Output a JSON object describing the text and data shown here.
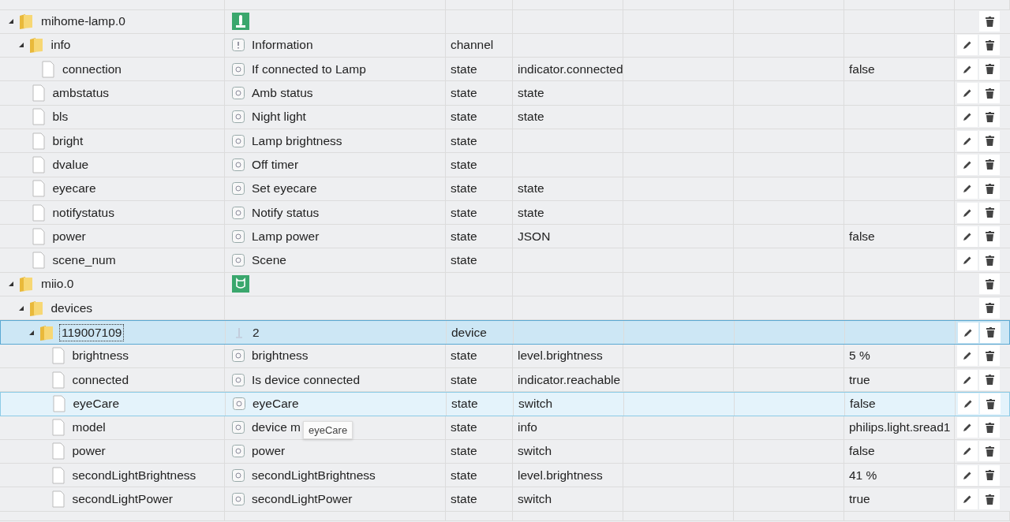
{
  "rows": [
    {
      "name": "mihome-lamp.0",
      "kind": "folder",
      "expanded": true,
      "editable": false,
      "selected": false,
      "hovered": false,
      "children": [
        {
          "name": "info",
          "kind": "folder",
          "expanded": true,
          "description": "Information",
          "type": "channel",
          "editable": true,
          "selected": false,
          "hovered": false,
          "children": [
            {
              "name": "connection",
              "kind": "file",
              "description": "If connected to Lamp",
              "type": "state",
              "role": "indicator.connected",
              "value": "false",
              "editable": true,
              "selected": false,
              "hovered": false
            }
          ]
        },
        {
          "name": "ambstatus",
          "kind": "file",
          "description": "Amb status",
          "type": "state",
          "role": "state",
          "editable": true,
          "selected": false,
          "hovered": false
        },
        {
          "name": "bls",
          "kind": "file",
          "description": "Night light",
          "type": "state",
          "role": "state",
          "editable": true,
          "selected": false,
          "hovered": false
        },
        {
          "name": "bright",
          "kind": "file",
          "description": "Lamp brightness",
          "type": "state",
          "editable": true,
          "selected": false,
          "hovered": false
        },
        {
          "name": "dvalue",
          "kind": "file",
          "description": "Off timer",
          "type": "state",
          "editable": true,
          "selected": false,
          "hovered": false
        },
        {
          "name": "eyecare",
          "kind": "file",
          "description": "Set eyecare",
          "type": "state",
          "role": "state",
          "editable": true,
          "selected": false,
          "hovered": false
        },
        {
          "name": "notifystatus",
          "kind": "file",
          "description": "Notify status",
          "type": "state",
          "role": "state",
          "editable": true,
          "selected": false,
          "hovered": false
        },
        {
          "name": "power",
          "kind": "file",
          "description": "Lamp power",
          "type": "state",
          "role": "JSON",
          "value": "false",
          "editable": true,
          "selected": false,
          "hovered": false
        },
        {
          "name": "scene_num",
          "kind": "file",
          "description": "Scene",
          "type": "state",
          "editable": true,
          "selected": false,
          "hovered": false
        }
      ]
    },
    {
      "name": "miio.0",
      "kind": "folder",
      "expanded": true,
      "editable": false,
      "selected": false,
      "hovered": false,
      "children": [
        {
          "name": "devices",
          "kind": "folder",
          "expanded": true,
          "editable": false,
          "selected": false,
          "hovered": false,
          "children": [
            {
              "name": "119007109",
              "kind": "folder",
              "expanded": true,
              "description": "2",
              "type": "device",
              "editable": true,
              "selected": true,
              "hovered": false,
              "children": [
                {
                  "name": "brightness",
                  "kind": "file",
                  "description": "brightness",
                  "type": "state",
                  "role": "level.brightness",
                  "value": "5 %",
                  "editable": true,
                  "selected": false,
                  "hovered": false
                },
                {
                  "name": "connected",
                  "kind": "file",
                  "description": "Is device connected",
                  "type": "state",
                  "role": "indicator.reachable",
                  "value": "true",
                  "editable": true,
                  "selected": false,
                  "hovered": false
                },
                {
                  "name": "eyeCare",
                  "kind": "file",
                  "description": "eyeCare",
                  "type": "state",
                  "role": "switch",
                  "value": "false",
                  "editable": true,
                  "selected": false,
                  "hovered": true
                },
                {
                  "name": "model",
                  "kind": "file",
                  "description": "device m",
                  "type": "state",
                  "role": "info",
                  "value": "philips.light.sread1",
                  "editable": true,
                  "selected": false,
                  "hovered": false
                },
                {
                  "name": "power",
                  "kind": "file",
                  "description": "power",
                  "type": "state",
                  "role": "switch",
                  "value": "false",
                  "editable": true,
                  "selected": false,
                  "hovered": false
                },
                {
                  "name": "secondLightBrightness",
                  "kind": "file",
                  "description": "secondLightBrightness",
                  "type": "state",
                  "role": "level.brightness",
                  "value": "41 %",
                  "editable": true,
                  "selected": false,
                  "hovered": false
                },
                {
                  "name": "secondLightPower",
                  "kind": "file",
                  "description": "secondLightPower",
                  "type": "state",
                  "role": "switch",
                  "value": "true",
                  "editable": true,
                  "selected": false,
                  "hovered": false
                }
              ]
            }
          ]
        }
      ]
    }
  ],
  "tooltip": {
    "text": "eyeCare"
  }
}
